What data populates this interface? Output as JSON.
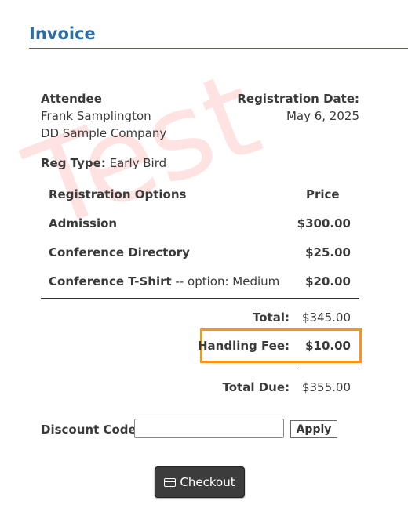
{
  "page": {
    "title": "Invoice",
    "watermark": "Test"
  },
  "attendee": {
    "label": "Attendee",
    "name": "Frank Samplington",
    "company": "DD Sample Company"
  },
  "registration_date": {
    "label": "Registration Date:",
    "value": "May 6, 2025"
  },
  "reg_type": {
    "label": "Reg Type:",
    "value": "Early Bird"
  },
  "options_table": {
    "header_options": "Registration Options",
    "header_price": "Price",
    "rows": [
      {
        "name": "Admission",
        "detail": "",
        "price": "$300.00"
      },
      {
        "name": "Conference Directory",
        "detail": "",
        "price": "$25.00"
      },
      {
        "name": "Conference T-Shirt",
        "detail": " -- option: Medium",
        "price": "$20.00"
      }
    ]
  },
  "totals": {
    "total_label": "Total:",
    "total_value": "$345.00",
    "fee_label": "Handling Fee:",
    "fee_value": "$10.00",
    "due_label": "Total Due:",
    "due_value": "$355.00",
    "highlight_color": "#f7941d"
  },
  "discount": {
    "label": "Discount Code:",
    "value": "",
    "apply_label": "Apply"
  },
  "checkout": {
    "label": "Checkout",
    "icon": "credit-card-icon"
  }
}
